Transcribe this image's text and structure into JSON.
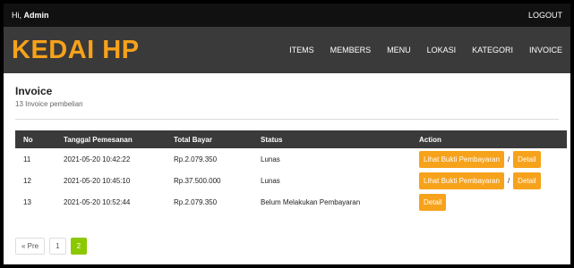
{
  "topbar": {
    "greeting": "Hi, ",
    "username": "Admin",
    "logout": "LOGOUT"
  },
  "brand": "KEDAI HP",
  "nav": [
    "ITEMS",
    "MEMBERS",
    "MENU",
    "LOKASI",
    "KATEGORI",
    "INVOICE"
  ],
  "page": {
    "title": "Invoice",
    "subtitle": "13 Invoice pembelian"
  },
  "table": {
    "headers": [
      "No",
      "Tanggal Pemesanan",
      "Total Bayar",
      "Status",
      "Action"
    ],
    "rows": [
      {
        "no": "11",
        "tanggal": "2021-05-20 10:42:22",
        "total": "Rp.2.079.350",
        "status": "Lunas",
        "bukti": "Lihat Bukti Pembayaran",
        "sep": "/",
        "detail": "Detail"
      },
      {
        "no": "12",
        "tanggal": "2021-05-20 10:45:10",
        "total": "Rp.37.500.000",
        "status": "Lunas",
        "bukti": "Lihat Bukti Pembayaran",
        "sep": "/",
        "detail": "Detail"
      },
      {
        "no": "13",
        "tanggal": "2021-05-20 10:52:44",
        "total": "Rp.2.079.350",
        "status": "Belum Melakukan Pembayaran",
        "detail": "Detail"
      }
    ]
  },
  "pagination": {
    "prev": "« Pre",
    "pages": [
      "1",
      "2"
    ],
    "active": "2"
  },
  "colors": {
    "accent": "#f7a21b",
    "header_bg": "#3a3a3a",
    "topbar_bg": "#111111",
    "active_page": "#8cc800"
  }
}
